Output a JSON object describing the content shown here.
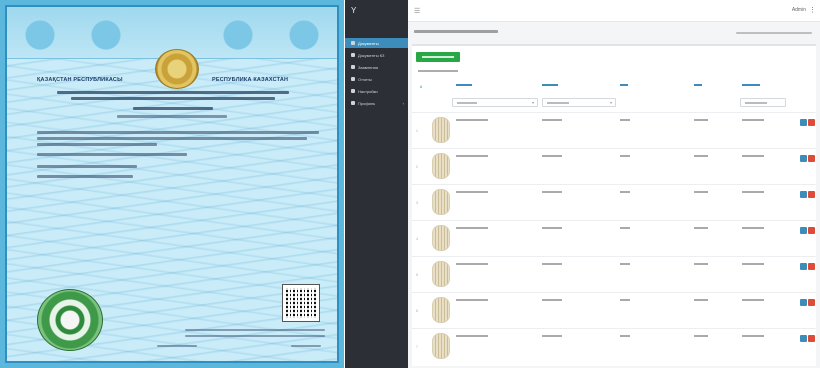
{
  "certificate": {
    "country_left": "ҚАЗАҚСТАН РЕСПУБЛИКАСЫ",
    "country_right": "РЕСПУБЛИКА КАЗАХСТАН"
  },
  "sidebar": {
    "logo": "Y",
    "items": [
      {
        "label": "Документы",
        "active": true
      },
      {
        "label": "Документы КЗ",
        "active": false
      },
      {
        "label": "Заявления",
        "active": false
      },
      {
        "label": "Отчеты",
        "active": false
      },
      {
        "label": "Настройки",
        "active": false
      },
      {
        "label": "Профиль",
        "active": false
      }
    ]
  },
  "topbar": {
    "menu_icon": "☰",
    "user": "Admin",
    "more_icon": "⋮"
  },
  "main": {
    "add_button": "",
    "columns": [
      "#",
      "",
      "",
      "",
      "",
      "",
      ""
    ],
    "rows": [
      {
        "num": "1"
      },
      {
        "num": "2"
      },
      {
        "num": "3"
      },
      {
        "num": "4"
      },
      {
        "num": "5"
      },
      {
        "num": "6"
      },
      {
        "num": "7"
      }
    ]
  },
  "colors": {
    "sidebar_bg": "#2c3036",
    "accent": "#3c8dbc",
    "add_button": "#28a745",
    "delete_button": "#dd4b39",
    "certificate_bg": "#c9ecf8"
  }
}
